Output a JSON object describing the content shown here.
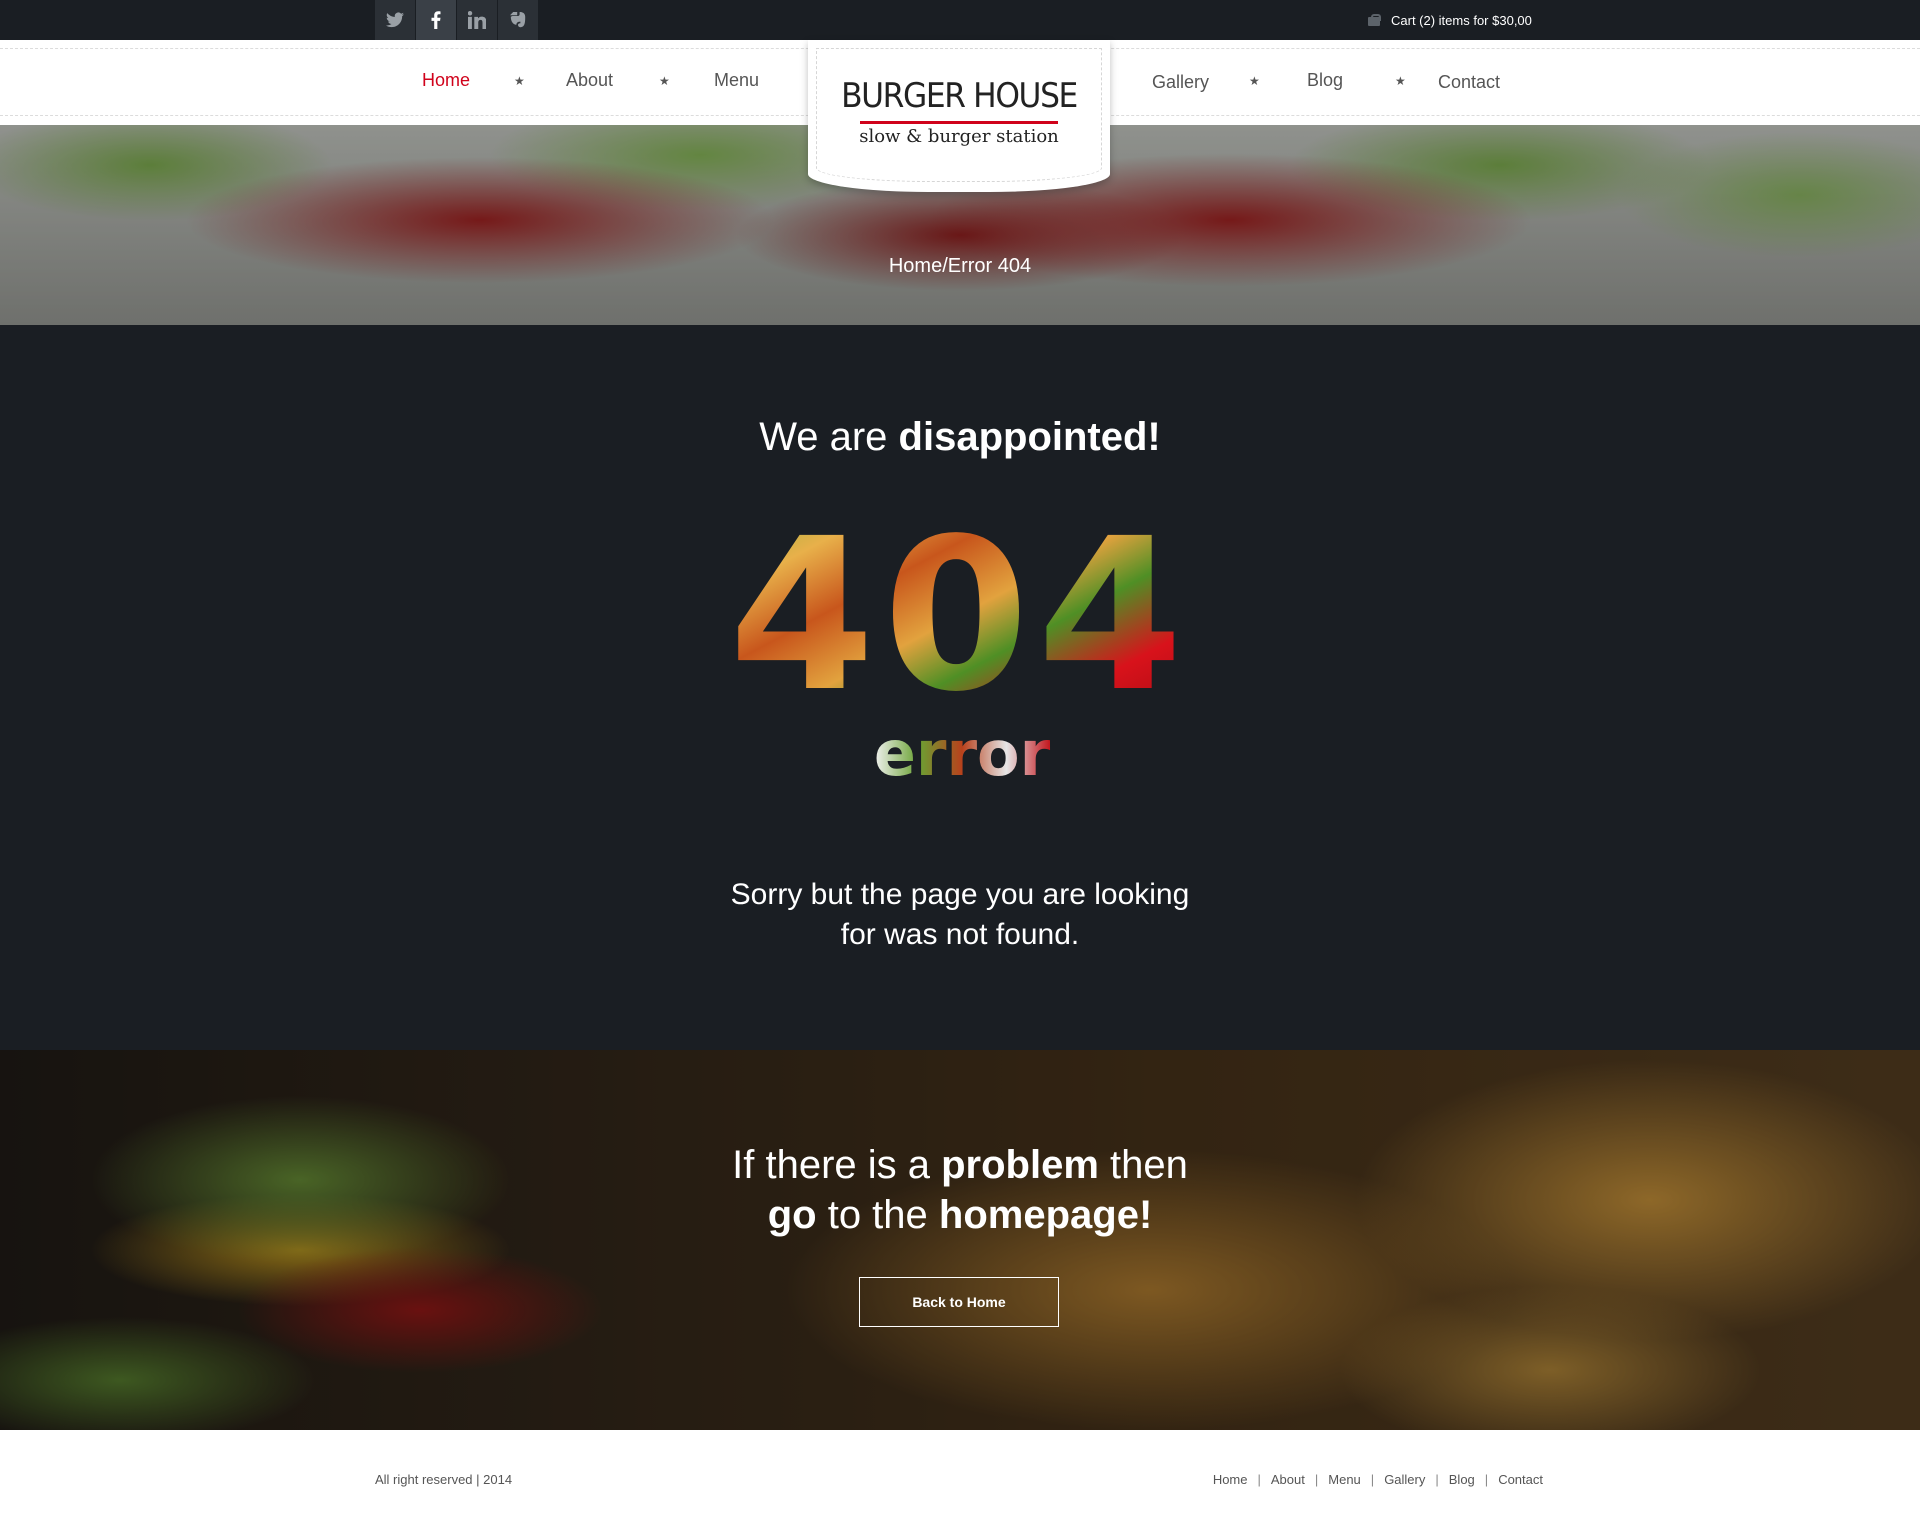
{
  "topbar": {
    "social": [
      {
        "icon": "twitter-icon",
        "glyph": "🐦"
      },
      {
        "icon": "facebook-icon",
        "glyph": "f"
      },
      {
        "icon": "linkedin-icon",
        "glyph": "in"
      },
      {
        "icon": "evernote-icon",
        "glyph": "✋"
      }
    ],
    "cart_text": "Cart (2) items for $30,00"
  },
  "nav": {
    "left": [
      "Home",
      "About",
      "Menu"
    ],
    "right": [
      "Gallery",
      "Blog",
      "Contact"
    ],
    "active": "Home",
    "logo_title": "BURGER HOUSE",
    "logo_subtitle": "slow & burger station"
  },
  "breadcrumb": "Home/Error 404",
  "error": {
    "headline_regular": "We are ",
    "headline_bold": "disappointed!",
    "code": "404",
    "word": "error",
    "message_line1": "Sorry but the page you are looking",
    "message_line2": "for was not found."
  },
  "problem": {
    "line1_a": "If there is a ",
    "line1_b": "problem",
    "line1_c": " then",
    "line2_a": "go",
    "line2_b": " to the ",
    "line2_c": "homepage!",
    "button": "Back to Home"
  },
  "footer": {
    "copyright": "All right reserved | 2014",
    "links": [
      "Home",
      "About",
      "Menu",
      "Gallery",
      "Blog",
      "Contact"
    ]
  },
  "colors": {
    "accent": "#d0021b",
    "dark": "#1a1e23"
  }
}
